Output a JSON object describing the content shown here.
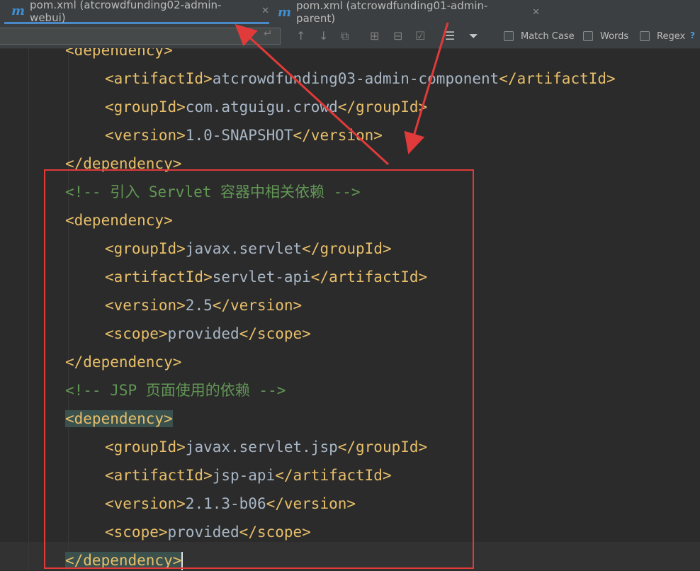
{
  "tabs": [
    {
      "icon": "maven-m-icon",
      "glyph": "m",
      "label": "pom.xml (atcrowdfunding02-admin-webui)",
      "active": true
    },
    {
      "icon": "maven-m-icon",
      "glyph": "m",
      "label": "pom.xml (atcrowdfunding01-admin-parent)",
      "active": false
    }
  ],
  "close_glyph": "✕",
  "findbar": {
    "search_value": "",
    "newline_glyph": "↵",
    "tool_glyphs": [
      "↑",
      "↓",
      "⧉",
      "⊞",
      "⊟",
      "☑",
      "☰",
      "⏷"
    ],
    "options": [
      "Match Case",
      "Words",
      "Regex"
    ],
    "help_glyph": "?"
  },
  "code_lines": [
    {
      "indent": 1,
      "parts": [
        {
          "t": "tag",
          "v": "<dependency>"
        }
      ]
    },
    {
      "indent": 2,
      "parts": [
        {
          "t": "tag",
          "v": "<artifactId>"
        },
        {
          "t": "txt",
          "v": "atcrowdfunding03-admin-component"
        },
        {
          "t": "tag",
          "v": "</artifactId>"
        }
      ]
    },
    {
      "indent": 2,
      "parts": [
        {
          "t": "tag",
          "v": "<groupId>"
        },
        {
          "t": "txt",
          "v": "com.atguigu.crowd"
        },
        {
          "t": "tag",
          "v": "</groupId>"
        }
      ]
    },
    {
      "indent": 2,
      "parts": [
        {
          "t": "tag",
          "v": "<version>"
        },
        {
          "t": "txt",
          "v": "1.0-SNAPSHOT"
        },
        {
          "t": "tag",
          "v": "</version>"
        }
      ]
    },
    {
      "indent": 1,
      "parts": [
        {
          "t": "tag",
          "v": "</dependency>"
        }
      ]
    },
    {
      "indent": 1,
      "parts": [
        {
          "t": "cmt",
          "v": "<!-- 引入 Servlet 容器中相关依赖 -->"
        }
      ]
    },
    {
      "indent": 1,
      "parts": [
        {
          "t": "tag",
          "v": "<dependency>"
        }
      ]
    },
    {
      "indent": 2,
      "parts": [
        {
          "t": "tag",
          "v": "<groupId>"
        },
        {
          "t": "txt",
          "v": "javax.servlet"
        },
        {
          "t": "tag",
          "v": "</groupId>"
        }
      ]
    },
    {
      "indent": 2,
      "parts": [
        {
          "t": "tag",
          "v": "<artifactId>"
        },
        {
          "t": "txt",
          "v": "servlet-api"
        },
        {
          "t": "tag",
          "v": "</artifactId>"
        }
      ]
    },
    {
      "indent": 2,
      "parts": [
        {
          "t": "tag",
          "v": "<version>"
        },
        {
          "t": "txt",
          "v": "2.5"
        },
        {
          "t": "tag",
          "v": "</version>"
        }
      ]
    },
    {
      "indent": 2,
      "parts": [
        {
          "t": "tag",
          "v": "<scope>"
        },
        {
          "t": "txt",
          "v": "provided"
        },
        {
          "t": "tag",
          "v": "</scope>"
        }
      ]
    },
    {
      "indent": 1,
      "parts": [
        {
          "t": "tag",
          "v": "</dependency>"
        }
      ]
    },
    {
      "indent": 1,
      "parts": [
        {
          "t": "cmt",
          "v": "<!-- JSP 页面使用的依赖 -->"
        }
      ]
    },
    {
      "indent": 1,
      "parts": [
        {
          "t": "tag",
          "v": "<dependency>",
          "hl": true
        }
      ]
    },
    {
      "indent": 2,
      "parts": [
        {
          "t": "tag",
          "v": "<groupId>"
        },
        {
          "t": "txt",
          "v": "javax.servlet.jsp"
        },
        {
          "t": "tag",
          "v": "</groupId>"
        }
      ]
    },
    {
      "indent": 2,
      "parts": [
        {
          "t": "tag",
          "v": "<artifactId>"
        },
        {
          "t": "txt",
          "v": "jsp-api"
        },
        {
          "t": "tag",
          "v": "</artifactId>"
        }
      ]
    },
    {
      "indent": 2,
      "parts": [
        {
          "t": "tag",
          "v": "<version>"
        },
        {
          "t": "txt",
          "v": "2.1.3-b06"
        },
        {
          "t": "tag",
          "v": "</version>"
        }
      ]
    },
    {
      "indent": 2,
      "parts": [
        {
          "t": "tag",
          "v": "<scope>"
        },
        {
          "t": "txt",
          "v": "provided"
        },
        {
          "t": "tag",
          "v": "</scope>"
        }
      ]
    },
    {
      "indent": 1,
      "parts": [
        {
          "t": "tag",
          "v": "</dependency>",
          "hl": true
        },
        {
          "t": "cursor",
          "v": ""
        }
      ]
    }
  ],
  "colors": {
    "tag": "#e8bf6a",
    "text": "#a9b7c6",
    "comment": "#629755",
    "annotation": "#e03a3a",
    "accent": "#4a88c7"
  }
}
